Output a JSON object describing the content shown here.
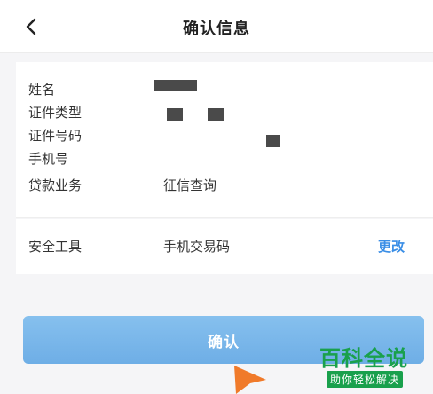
{
  "header": {
    "title": "确认信息",
    "back_icon": "chevron-left-icon"
  },
  "info": {
    "rows": [
      {
        "label": "姓名",
        "value": ""
      },
      {
        "label": "证件类型",
        "value": ""
      },
      {
        "label": "证件号码",
        "value": ""
      },
      {
        "label": "手机号",
        "value": ""
      },
      {
        "label": "贷款业务",
        "value": "征信查询"
      }
    ]
  },
  "security": {
    "label": "安全工具",
    "value": "手机交易码",
    "change_label": "更改"
  },
  "confirm_label": "确认",
  "watermark": {
    "title": "百科全说",
    "subtitle": "助你轻松解决"
  },
  "colors": {
    "accent": "#3a8ee6",
    "button": "#78b6ea",
    "pointer": "#f07a2a",
    "watermark": "#19a04c"
  }
}
